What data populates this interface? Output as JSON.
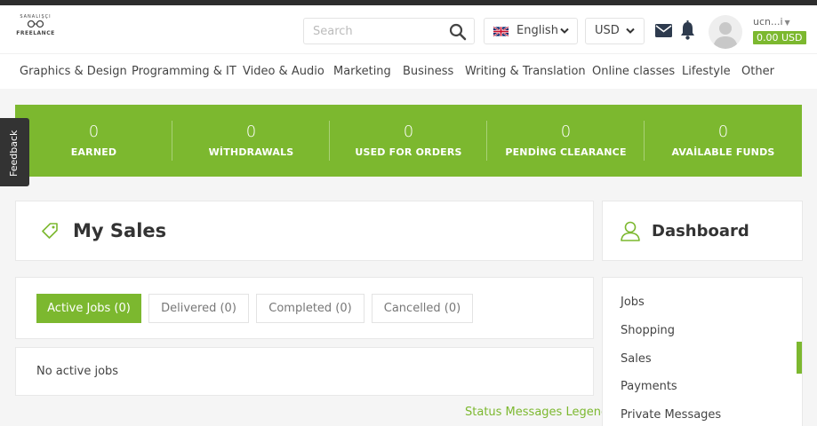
{
  "header": {
    "logo": {
      "arc_text": "SANALIŞÇI",
      "name": "FREELANCE"
    },
    "search": {
      "placeholder": "Search",
      "icon": "search-icon"
    },
    "language": {
      "label": "English",
      "icon": "uk-flag-icon"
    },
    "currency": {
      "label": "USD"
    },
    "user": {
      "name": "ucn...i",
      "balance": "0.00 USD"
    },
    "colors": {
      "accent": "#7cb82f",
      "topbar": "#2d2d2d"
    }
  },
  "nav": {
    "items": [
      {
        "label": "Graphics & Design"
      },
      {
        "label": "Programming & IT"
      },
      {
        "label": "Video & Audio"
      },
      {
        "label": "Marketing"
      },
      {
        "label": "Business"
      },
      {
        "label": "Writing & Translation"
      },
      {
        "label": "Online classes"
      },
      {
        "label": "Lifestyle"
      },
      {
        "label": "Other"
      }
    ]
  },
  "stats": [
    {
      "value": "0",
      "label": "EARNED"
    },
    {
      "value": "0",
      "label": "WİTHDRAWALS"
    },
    {
      "value": "0",
      "label": "USED FOR ORDERS"
    },
    {
      "value": "0",
      "label": "PENDİNG CLEARANCE"
    },
    {
      "value": "0",
      "label": "AVAİLABLE FUNDS"
    }
  ],
  "feedback": {
    "label": "Feedback"
  },
  "sales": {
    "title": "My Sales",
    "tabs": [
      {
        "label": "Active Jobs (0)",
        "active": true
      },
      {
        "label": "Delivered (0)",
        "active": false
      },
      {
        "label": "Completed (0)",
        "active": false
      },
      {
        "label": "Cancelled (0)",
        "active": false
      }
    ],
    "empty_text": "No active jobs",
    "legend_link": "Status Messages Legend"
  },
  "dashboard": {
    "title": "Dashboard",
    "menu": [
      {
        "label": "Jobs"
      },
      {
        "label": "Shopping"
      },
      {
        "label": "Sales",
        "active": true
      },
      {
        "label": "Payments"
      },
      {
        "label": "Private Messages"
      }
    ]
  }
}
